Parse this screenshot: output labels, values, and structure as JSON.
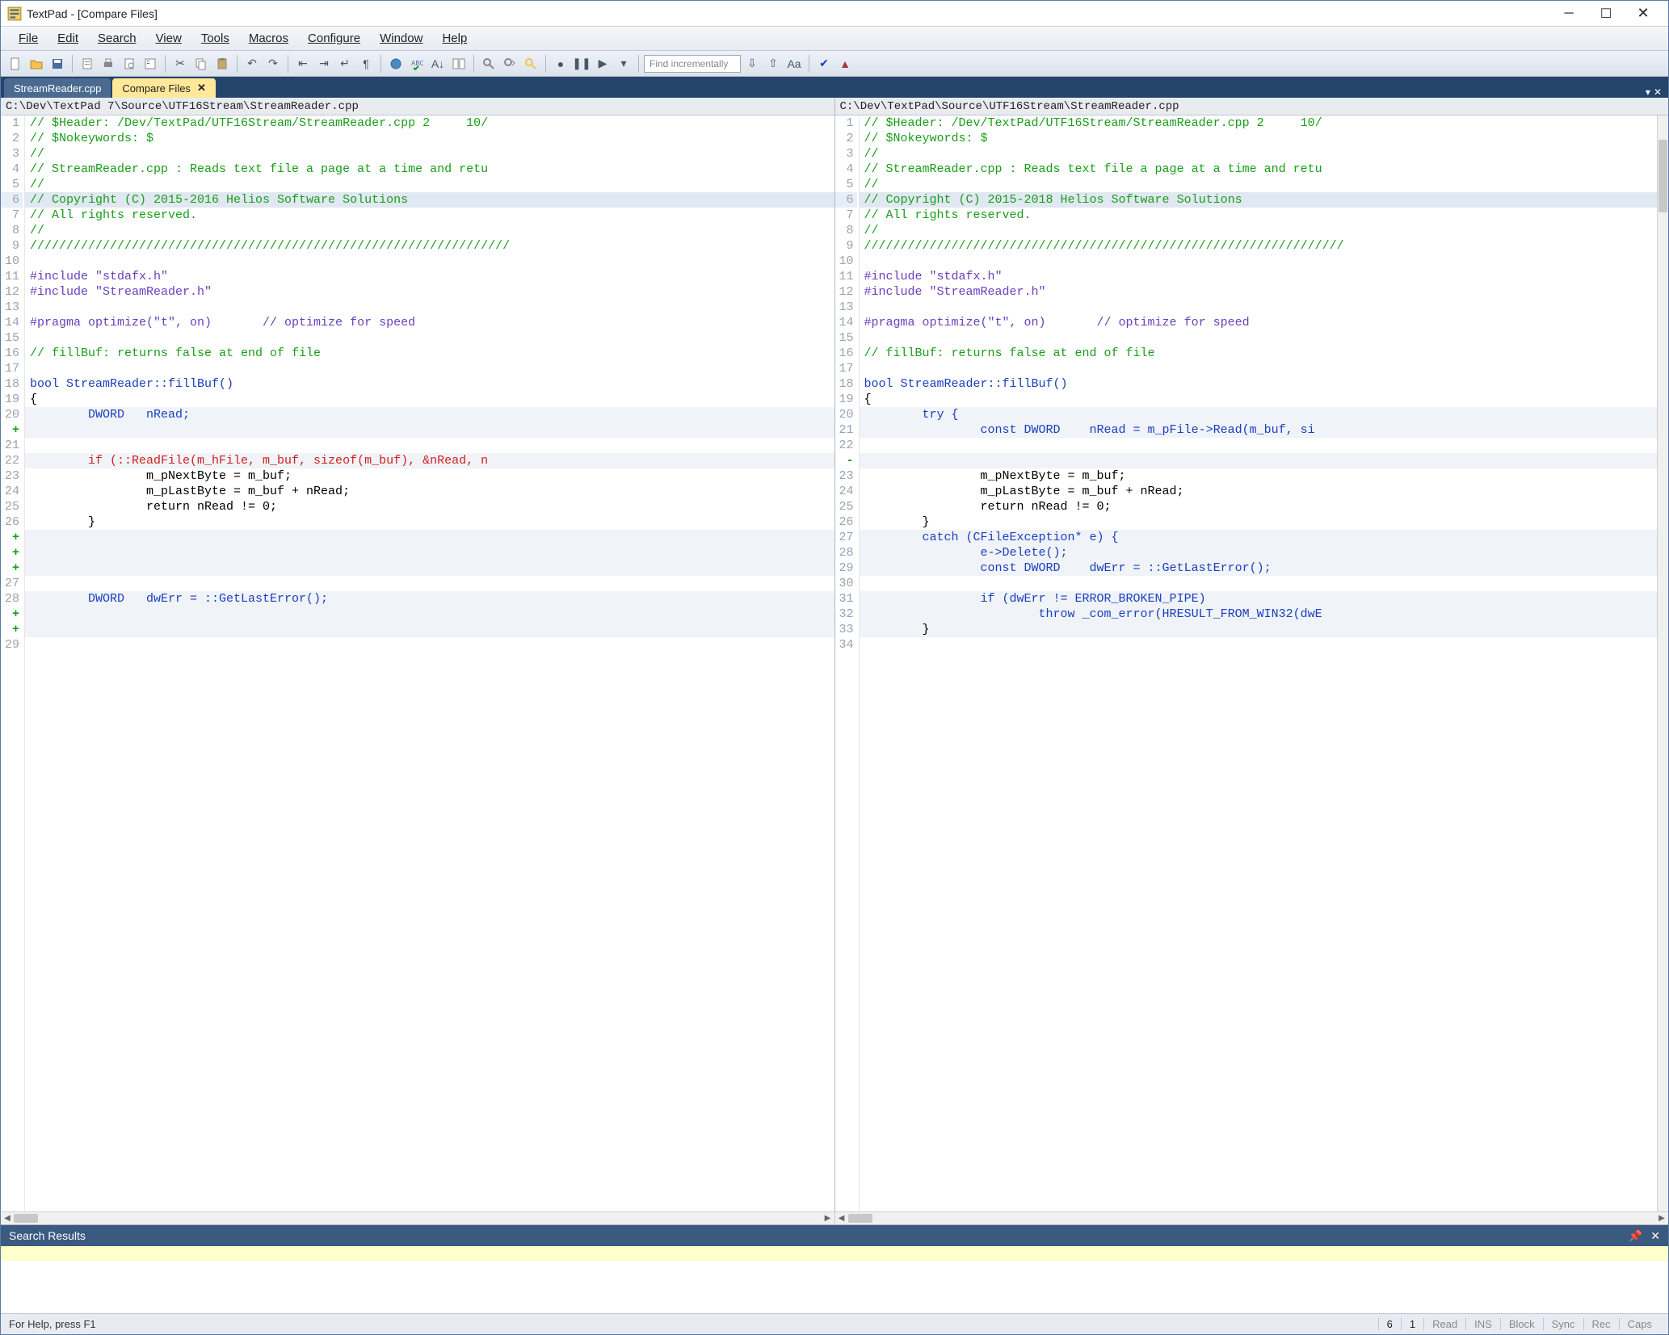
{
  "title": "TextPad - [Compare Files]",
  "menus": [
    "File",
    "Edit",
    "Search",
    "View",
    "Tools",
    "Macros",
    "Configure",
    "Window",
    "Help"
  ],
  "find_placeholder": "Find incrementally",
  "tabs": [
    {
      "label": "StreamReader.cpp",
      "active": false
    },
    {
      "label": "Compare Files",
      "active": true,
      "closable": true
    }
  ],
  "left": {
    "path": "C:\\Dev\\TextPad 7\\Source\\UTF16Stream\\StreamReader.cpp",
    "lines": [
      {
        "n": "1",
        "kind": "cm",
        "text": "// $Header: /Dev/TextPad/UTF16Stream/StreamReader.cpp 2     10/"
      },
      {
        "n": "2",
        "kind": "cm",
        "text": "// $Nokeywords: $"
      },
      {
        "n": "3",
        "kind": "cm",
        "text": "//"
      },
      {
        "n": "4",
        "kind": "cm",
        "text": "// StreamReader.cpp : Reads text file a page at a time and retu"
      },
      {
        "n": "5",
        "kind": "cm",
        "text": "//"
      },
      {
        "n": "6",
        "kind": "cm",
        "text": "// Copyright (C) 2015-2016 Helios Software Solutions",
        "diff": true,
        "current": true
      },
      {
        "n": "7",
        "kind": "cm",
        "text": "// All rights reserved."
      },
      {
        "n": "8",
        "kind": "cm",
        "text": "//"
      },
      {
        "n": "9",
        "kind": "cm",
        "text": "//////////////////////////////////////////////////////////////////"
      },
      {
        "n": "10",
        "text": ""
      },
      {
        "n": "11",
        "kind": "pp",
        "text": "#include \"stdafx.h\""
      },
      {
        "n": "12",
        "kind": "pp",
        "text": "#include \"StreamReader.h\""
      },
      {
        "n": "13",
        "text": ""
      },
      {
        "n": "14",
        "kind": "pp",
        "text": "#pragma optimize(\"t\", on)       // optimize for speed"
      },
      {
        "n": "15",
        "text": ""
      },
      {
        "n": "16",
        "kind": "cm",
        "text": "// fillBuf: returns false at end of file"
      },
      {
        "n": "17",
        "text": ""
      },
      {
        "n": "18",
        "kind": "fn",
        "text": "bool StreamReader::fillBuf()"
      },
      {
        "n": "19",
        "text": "{"
      },
      {
        "n": "20",
        "kind": "kw",
        "text": "        DWORD   nRead;",
        "diff": true
      },
      {
        "n": "+",
        "kind": "mark",
        "text": "",
        "diff": true
      },
      {
        "n": "21",
        "text": ""
      },
      {
        "n": "22",
        "kind": "rm",
        "text": "        if (::ReadFile(m_hFile, m_buf, sizeof(m_buf), &nRead, n",
        "diff": true
      },
      {
        "n": "23",
        "text": "                m_pNextByte = m_buf;"
      },
      {
        "n": "24",
        "text": "                m_pLastByte = m_buf + nRead;"
      },
      {
        "n": "25",
        "text": "                return nRead != 0;"
      },
      {
        "n": "26",
        "text": "        }"
      },
      {
        "n": "+",
        "kind": "mark",
        "text": "",
        "diff": true
      },
      {
        "n": "+",
        "kind": "mark",
        "text": "",
        "diff": true
      },
      {
        "n": "+",
        "kind": "mark",
        "text": "",
        "diff": true
      },
      {
        "n": "27",
        "text": ""
      },
      {
        "n": "28",
        "kind": "kw",
        "text": "        DWORD   dwErr = ::GetLastError();",
        "diff": true
      },
      {
        "n": "+",
        "kind": "mark",
        "text": "",
        "diff": true
      },
      {
        "n": "+",
        "kind": "mark",
        "text": "",
        "diff": true
      },
      {
        "n": "29",
        "text": ""
      }
    ]
  },
  "right": {
    "path": "C:\\Dev\\TextPad\\Source\\UTF16Stream\\StreamReader.cpp",
    "lines": [
      {
        "n": "1",
        "kind": "cm",
        "text": "// $Header: /Dev/TextPad/UTF16Stream/StreamReader.cpp 2     10/"
      },
      {
        "n": "2",
        "kind": "cm",
        "text": "// $Nokeywords: $"
      },
      {
        "n": "3",
        "kind": "cm",
        "text": "//"
      },
      {
        "n": "4",
        "kind": "cm",
        "text": "// StreamReader.cpp : Reads text file a page at a time and retu"
      },
      {
        "n": "5",
        "kind": "cm",
        "text": "//"
      },
      {
        "n": "6",
        "kind": "cm",
        "text": "// Copyright (C) 2015-2018 Helios Software Solutions",
        "diff": true,
        "current": true
      },
      {
        "n": "7",
        "kind": "cm",
        "text": "// All rights reserved."
      },
      {
        "n": "8",
        "kind": "cm",
        "text": "//"
      },
      {
        "n": "9",
        "kind": "cm",
        "text": "//////////////////////////////////////////////////////////////////"
      },
      {
        "n": "10",
        "text": ""
      },
      {
        "n": "11",
        "kind": "pp",
        "text": "#include \"stdafx.h\""
      },
      {
        "n": "12",
        "kind": "pp",
        "text": "#include \"StreamReader.h\""
      },
      {
        "n": "13",
        "text": ""
      },
      {
        "n": "14",
        "kind": "pp",
        "text": "#pragma optimize(\"t\", on)       // optimize for speed"
      },
      {
        "n": "15",
        "text": ""
      },
      {
        "n": "16",
        "kind": "cm",
        "text": "// fillBuf: returns false at end of file"
      },
      {
        "n": "17",
        "text": ""
      },
      {
        "n": "18",
        "kind": "fn",
        "text": "bool StreamReader::fillBuf()"
      },
      {
        "n": "19",
        "text": "{"
      },
      {
        "n": "20",
        "kind": "kw",
        "text": "        try {",
        "diff": true
      },
      {
        "n": "21",
        "kind": "kw",
        "text": "                const DWORD    nRead = m_pFile->Read(m_buf, si",
        "diff": true
      },
      {
        "n": "22",
        "text": ""
      },
      {
        "n": "-",
        "kind": "mark",
        "text": "",
        "diff": true
      },
      {
        "n": "23",
        "text": "                m_pNextByte = m_buf;"
      },
      {
        "n": "24",
        "text": "                m_pLastByte = m_buf + nRead;"
      },
      {
        "n": "25",
        "text": "                return nRead != 0;"
      },
      {
        "n": "26",
        "text": "        }"
      },
      {
        "n": "27",
        "kind": "kw",
        "text": "        catch (CFileException* e) {",
        "diff": true
      },
      {
        "n": "28",
        "kind": "kw",
        "text": "                e->Delete();",
        "diff": true
      },
      {
        "n": "29",
        "kind": "kw",
        "text": "                const DWORD    dwErr = ::GetLastError();",
        "diff": true
      },
      {
        "n": "30",
        "text": ""
      },
      {
        "n": "31",
        "kind": "kw",
        "text": "                if (dwErr != ERROR_BROKEN_PIPE)",
        "diff": true
      },
      {
        "n": "32",
        "kind": "kw",
        "text": "                        throw _com_error(HRESULT_FROM_WIN32(dwE",
        "diff": true
      },
      {
        "n": "33",
        "text": "        }",
        "diff": true
      },
      {
        "n": "34",
        "text": ""
      }
    ]
  },
  "search_panel_title": "Search Results",
  "status": {
    "help": "For Help, press F1",
    "line": "6",
    "col": "1",
    "cells": [
      "Read",
      "INS",
      "Block",
      "Sync",
      "Rec",
      "Caps"
    ]
  }
}
